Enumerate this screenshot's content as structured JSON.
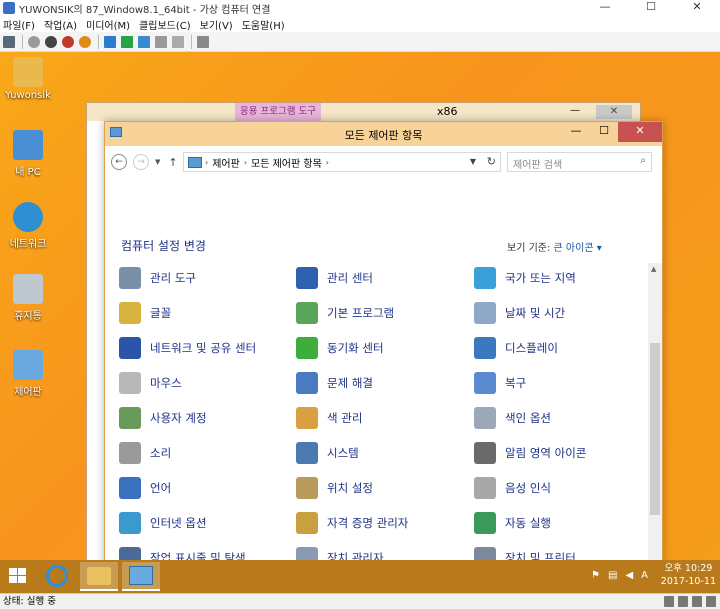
{
  "host": {
    "title": "YUWONSIK의 87_Window8.1_64bit - 가상 컴퓨터 연결",
    "window_buttons": [
      "—",
      "☐",
      "✕"
    ],
    "menu": [
      "파일(F)",
      "작업(A)",
      "미디어(M)",
      "클립보드(C)",
      "보기(V)",
      "도움말(H)"
    ],
    "status": "상태: 실행 중"
  },
  "desktop_icons": [
    {
      "label": "Yuwonsik",
      "color": "#e9b94d"
    },
    {
      "label": "내 PC",
      "color": "#4a8fd4"
    },
    {
      "label": "네트워크",
      "color": "#2f8fd0"
    },
    {
      "label": "휴지통",
      "color": "#bfc7cf"
    },
    {
      "label": "제어판",
      "color": "#6aaae0"
    }
  ],
  "background_window": {
    "tools_label": "응용 프로그램 도구",
    "title": "x86",
    "close": "✕",
    "min": "—"
  },
  "control_panel": {
    "title": "모든 제어판 항목",
    "buttons": {
      "min": "—",
      "max": "☐",
      "close": "✕"
    },
    "address": [
      "제어판",
      "모든 제어판 항목"
    ],
    "search_placeholder": "제어판 검색",
    "heading": "컴퓨터 설정 변경",
    "view_by_label": "보기 기준:",
    "view_by_value": "큰 아이콘 ▾",
    "items": [
      {
        "label": "관리 도구",
        "color": "#7a8fa8"
      },
      {
        "label": "관리 센터",
        "color": "#2f5fb0"
      },
      {
        "label": "국가 또는 지역",
        "color": "#3aa0d8"
      },
      {
        "label": "글꼴",
        "color": "#d9b340"
      },
      {
        "label": "기본 프로그램",
        "color": "#5aa55a"
      },
      {
        "label": "날짜 및 시간",
        "color": "#8fa8c8"
      },
      {
        "label": "네트워크 및 공유 센터",
        "color": "#2a55a8"
      },
      {
        "label": "동기화 센터",
        "color": "#3cae3c"
      },
      {
        "label": "디스플레이",
        "color": "#3a78c0"
      },
      {
        "label": "마우스",
        "color": "#b8b8b8"
      },
      {
        "label": "문제 해결",
        "color": "#4a7ac0"
      },
      {
        "label": "복구",
        "color": "#5a8ad0"
      },
      {
        "label": "사용자 계정",
        "color": "#6a9a5a"
      },
      {
        "label": "색 관리",
        "color": "#d8a040"
      },
      {
        "label": "색인 옵션",
        "color": "#9aa8b8"
      },
      {
        "label": "소리",
        "color": "#9a9a9a"
      },
      {
        "label": "시스템",
        "color": "#4a7ab0"
      },
      {
        "label": "알림 영역 아이콘",
        "color": "#6a6a6a"
      },
      {
        "label": "언어",
        "color": "#3a70c0"
      },
      {
        "label": "위치 설정",
        "color": "#b89a5a"
      },
      {
        "label": "음성 인식",
        "color": "#a8a8a8"
      },
      {
        "label": "인터넷 옵션",
        "color": "#3a9ad0"
      },
      {
        "label": "자격 증명 관리자",
        "color": "#c8a040"
      },
      {
        "label": "자동 실행",
        "color": "#3a9a5a"
      },
      {
        "label": "작업 표시줄 및 탐색",
        "color": "#4a6a9a"
      },
      {
        "label": "장치 관리자",
        "color": "#8a9ab0"
      },
      {
        "label": "장치 및 프린터",
        "color": "#7a8a9a"
      }
    ]
  },
  "taskbar": {
    "time": "오후 10:29",
    "date": "2017-10-11",
    "ime": "A"
  }
}
